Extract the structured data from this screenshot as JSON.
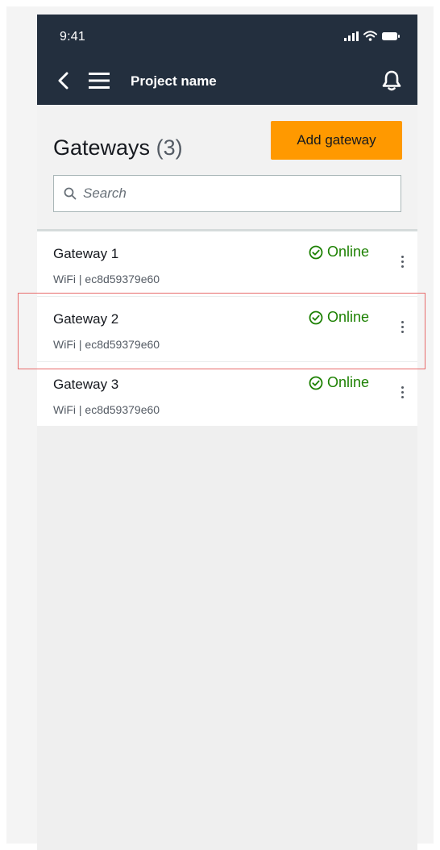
{
  "status_bar": {
    "time": "9:41",
    "icons": [
      "cellular-signal-icon",
      "wifi-icon",
      "battery-icon"
    ]
  },
  "header": {
    "back_icon": "chevron-left-icon",
    "menu_icon": "hamburger-menu-icon",
    "project_name": "Project name",
    "notification_icon": "bell-icon",
    "background_color": "#232f3e"
  },
  "page": {
    "title": "Gateways",
    "count": "(3)",
    "add_button_label": "Add gateway",
    "add_button_color": "#ff9900"
  },
  "search": {
    "placeholder": "Search",
    "icon": "search-icon"
  },
  "gateways": [
    {
      "name": "Gateway 1",
      "meta": "WiFi | ec8d59379e60",
      "status": "Online",
      "status_icon": "check-circle-icon",
      "status_color": "#1d8102",
      "more_icon": "more-vertical-icon"
    },
    {
      "name": "Gateway 2",
      "meta": "WiFi | ec8d59379e60",
      "status": "Online",
      "status_icon": "check-circle-icon",
      "status_color": "#1d8102",
      "more_icon": "more-vertical-icon"
    },
    {
      "name": "Gateway 3",
      "meta": "WiFi | ec8d59379e60",
      "status": "Online",
      "status_icon": "check-circle-icon",
      "status_color": "#1d8102",
      "more_icon": "more-vertical-icon"
    }
  ],
  "highlight": {
    "target": "Gateway 2",
    "color": "#e86b6b"
  }
}
